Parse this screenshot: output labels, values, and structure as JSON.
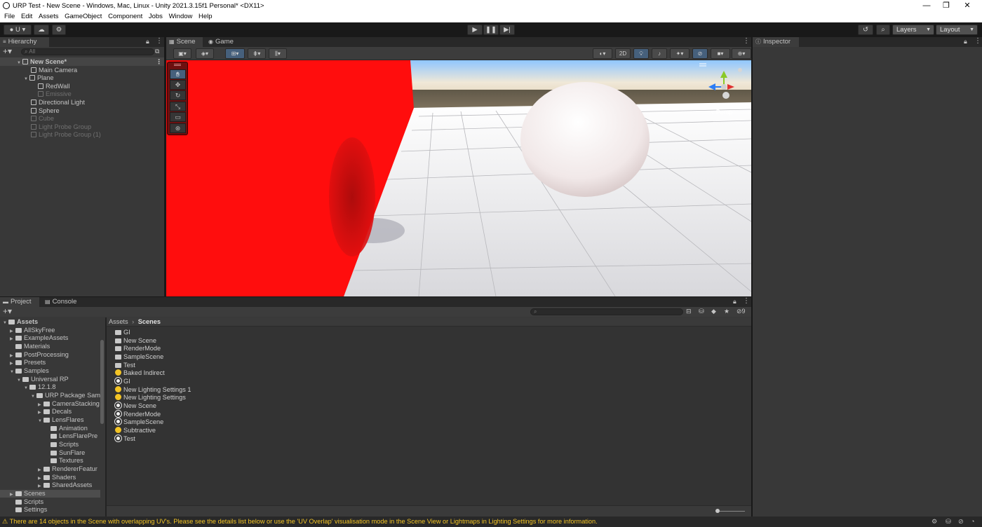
{
  "window": {
    "title": "URP Test - New Scene - Windows, Mac, Linux - Unity 2021.3.15f1 Personal* <DX11>",
    "minimize": "—",
    "restore": "❐",
    "close": "✕"
  },
  "menu": [
    "File",
    "Edit",
    "Assets",
    "GameObject",
    "Component",
    "Jobs",
    "Window",
    "Help"
  ],
  "toolbar": {
    "account_label": "U",
    "play_icon": "▶",
    "pause_icon": "❚❚",
    "step_icon": "▶|",
    "layers_label": "Layers",
    "layout_label": "Layout"
  },
  "hierarchy": {
    "tab_label": "Hierarchy",
    "search_placeholder": "All",
    "items": [
      {
        "label": "New Scene*",
        "depth": 0,
        "kind": "scene",
        "expanded": true
      },
      {
        "label": "Main Camera",
        "depth": 1,
        "kind": "object"
      },
      {
        "label": "Plane",
        "depth": 1,
        "kind": "object",
        "expanded": true
      },
      {
        "label": "RedWall",
        "depth": 2,
        "kind": "object"
      },
      {
        "label": "Emissive",
        "depth": 2,
        "kind": "object",
        "dim": true
      },
      {
        "label": "Directional Light",
        "depth": 1,
        "kind": "object"
      },
      {
        "label": "Sphere",
        "depth": 1,
        "kind": "object"
      },
      {
        "label": "Cube",
        "depth": 1,
        "kind": "object",
        "dim": true
      },
      {
        "label": "Light Probe Group",
        "depth": 1,
        "kind": "object",
        "dim": true
      },
      {
        "label": "Light Probe Group (1)",
        "depth": 1,
        "kind": "object",
        "dim": true
      }
    ]
  },
  "scene": {
    "tabs": [
      "Scene",
      "Game"
    ],
    "mode_2d_label": "2D",
    "persp_label": "Persp"
  },
  "inspector": {
    "tab_label": "Inspector"
  },
  "project": {
    "tabs": [
      "Project",
      "Console"
    ],
    "badge_count": "9",
    "breadcrumb": [
      "Assets",
      "Scenes"
    ],
    "tree": [
      {
        "label": "Assets",
        "depth": 0,
        "expanded": true,
        "bold": true
      },
      {
        "label": "AllSkyFree",
        "depth": 1,
        "arrow": true
      },
      {
        "label": "ExampleAssets",
        "depth": 1,
        "arrow": true
      },
      {
        "label": "Materials",
        "depth": 1
      },
      {
        "label": "PostProcessing",
        "depth": 1,
        "arrow": true
      },
      {
        "label": "Presets",
        "depth": 1,
        "arrow": true
      },
      {
        "label": "Samples",
        "depth": 1,
        "expanded": true
      },
      {
        "label": "Universal RP",
        "depth": 2,
        "expanded": true
      },
      {
        "label": "12.1.8",
        "depth": 3,
        "expanded": true
      },
      {
        "label": "URP Package Sam",
        "depth": 4,
        "expanded": true
      },
      {
        "label": "CameraStacking",
        "depth": 5,
        "arrow": true
      },
      {
        "label": "Decals",
        "depth": 5,
        "arrow": true
      },
      {
        "label": "LensFlares",
        "depth": 5,
        "expanded": true
      },
      {
        "label": "Animation",
        "depth": 6
      },
      {
        "label": "LensFlarePre",
        "depth": 6
      },
      {
        "label": "Scripts",
        "depth": 6
      },
      {
        "label": "SunFlare",
        "depth": 6
      },
      {
        "label": "Textures",
        "depth": 6
      },
      {
        "label": "RendererFeatur",
        "depth": 5,
        "arrow": true
      },
      {
        "label": "Shaders",
        "depth": 5,
        "arrow": true
      },
      {
        "label": "SharedAssets",
        "depth": 5,
        "arrow": true
      },
      {
        "label": "Scenes",
        "depth": 1,
        "arrow": true,
        "selected": true
      },
      {
        "label": "Scripts",
        "depth": 1
      },
      {
        "label": "Settings",
        "depth": 1
      }
    ],
    "files": [
      {
        "label": "GI",
        "kind": "folder"
      },
      {
        "label": "New Scene",
        "kind": "folder"
      },
      {
        "label": "RenderMode",
        "kind": "folder"
      },
      {
        "label": "SampleScene",
        "kind": "folder"
      },
      {
        "label": "Test",
        "kind": "folder"
      },
      {
        "label": "Baked Indirect",
        "kind": "light"
      },
      {
        "label": "GI",
        "kind": "scene"
      },
      {
        "label": "New Lighting Settings 1",
        "kind": "light"
      },
      {
        "label": "New Lighting Settings",
        "kind": "light"
      },
      {
        "label": "New Scene",
        "kind": "scene"
      },
      {
        "label": "RenderMode",
        "kind": "scene"
      },
      {
        "label": "SampleScene",
        "kind": "scene"
      },
      {
        "label": "Subtractive",
        "kind": "light"
      },
      {
        "label": "Test",
        "kind": "scene"
      }
    ]
  },
  "status": {
    "message": "There are 14 objects in the Scene with overlapping UV's. Please see the details list below or use the 'UV Overlap' visualisation mode in the Scene View or Lightmaps in Lighting Settings for more information."
  },
  "colors": {
    "wall": "#ff0d0d",
    "accent": "#46607c",
    "warning": "#f3c425"
  }
}
